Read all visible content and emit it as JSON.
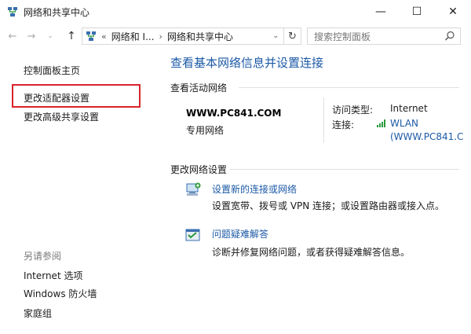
{
  "window": {
    "title": "网络和共享中心",
    "minimize_glyph": "—",
    "maximize_glyph": "☐",
    "close_glyph": "✕"
  },
  "navigation": {
    "back_glyph": "←",
    "forward_glyph": "→",
    "history_glyph": "⌄",
    "up_glyph": "↑",
    "address_prefix": "«",
    "breadcrumbs": [
      "网络和 I...",
      "网络和共享中心"
    ],
    "refresh_glyph": "↻"
  },
  "search": {
    "placeholder": "搜索控制面板"
  },
  "sidebar": {
    "items": [
      {
        "label": "控制面板主页"
      },
      {
        "label": "更改适配器设置"
      },
      {
        "label": "更改高级共享设置"
      }
    ],
    "see_also_heading": "另请参阅",
    "see_also": [
      {
        "label": "Internet 选项"
      },
      {
        "label": "Windows 防火墙"
      },
      {
        "label": "家庭组"
      }
    ]
  },
  "main": {
    "title": "查看基本网络信息并设置连接",
    "active_networks": {
      "heading": "查看活动网络",
      "network_name": "WWW.PC841.COM",
      "network_type": "专用网络",
      "access_type_label": "访问类型:",
      "access_type_value": "Internet",
      "connection_label": "连接:",
      "connection_value_line1": "WLAN",
      "connection_value_line2": "(WWW.PC841.C"
    },
    "change_settings": {
      "heading": "更改网络设置",
      "tasks": [
        {
          "link": "设置新的连接或网络",
          "description": "设置宽带、拨号或 VPN 连接；或设置路由器或接入点。",
          "icon": "network-setup-icon"
        },
        {
          "link": "问题疑难解答",
          "description": "诊断并修复网络问题，或者获得疑难解答信息。",
          "icon": "troubleshoot-icon"
        }
      ]
    }
  },
  "colors": {
    "link": "#1c5aa6",
    "highlight_box": "#d9242b"
  }
}
